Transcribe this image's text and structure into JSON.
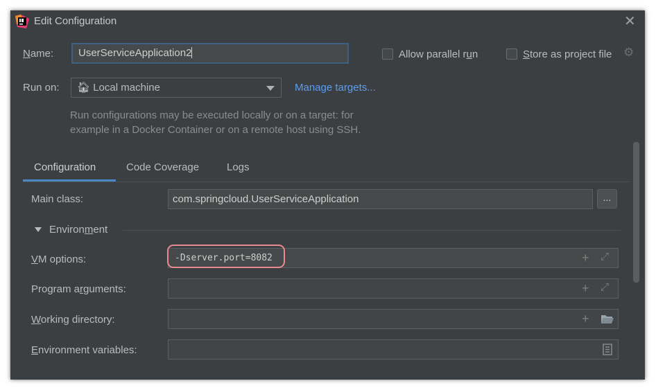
{
  "window": {
    "title": "Edit Configuration"
  },
  "name_row": {
    "label_accel": "N",
    "label_rest": "ame:",
    "value": "UserServiceApplication2",
    "allow_parallel_pre": "Allow parallel r",
    "allow_parallel_accel": "u",
    "allow_parallel_post": "n",
    "store_accel": "S",
    "store_rest": "tore as project file"
  },
  "run_on": {
    "label": "Run on:",
    "selected": "Local machine",
    "manage_link": "Manage targets...",
    "hint_line1": "Run configurations may be executed locally or on a target: for",
    "hint_line2": "example in a Docker Container or on a remote host using SSH."
  },
  "tabs": [
    {
      "label": "Configuration",
      "active": true
    },
    {
      "label": "Code Coverage",
      "active": false
    },
    {
      "label": "Logs",
      "active": false
    }
  ],
  "config": {
    "main_class_label": "Main class:",
    "main_class_value": "com.springcloud.UserServiceApplication",
    "browse_label": "...",
    "environment_pre": "Environ",
    "environment_accel": "m",
    "environment_post": "ent",
    "vm_label_accel": "V",
    "vm_label_rest": "M options:",
    "vm_value": "-Dserver.port=8082",
    "prog_args_pre": "Program a",
    "prog_args_accel": "r",
    "prog_args_post": "guments:",
    "prog_args_value": "",
    "workdir_accel": "W",
    "workdir_rest": "orking directory:",
    "workdir_value": "",
    "env_vars_accel": "E",
    "env_vars_rest": "nvironment variables:",
    "env_vars_value": ""
  },
  "icons": {
    "app": "intellij-app-icon",
    "close": "close-icon",
    "gear": "gear-icon",
    "home": "home-icon",
    "add": "plus-icon",
    "expand": "expand-icon",
    "folder": "folder-icon",
    "document": "document-icon"
  },
  "colors": {
    "background": "#3c3f41",
    "accent_link": "#589df6",
    "tab_underline": "#4a88c7",
    "highlight_annotation": "#e88a8f"
  }
}
